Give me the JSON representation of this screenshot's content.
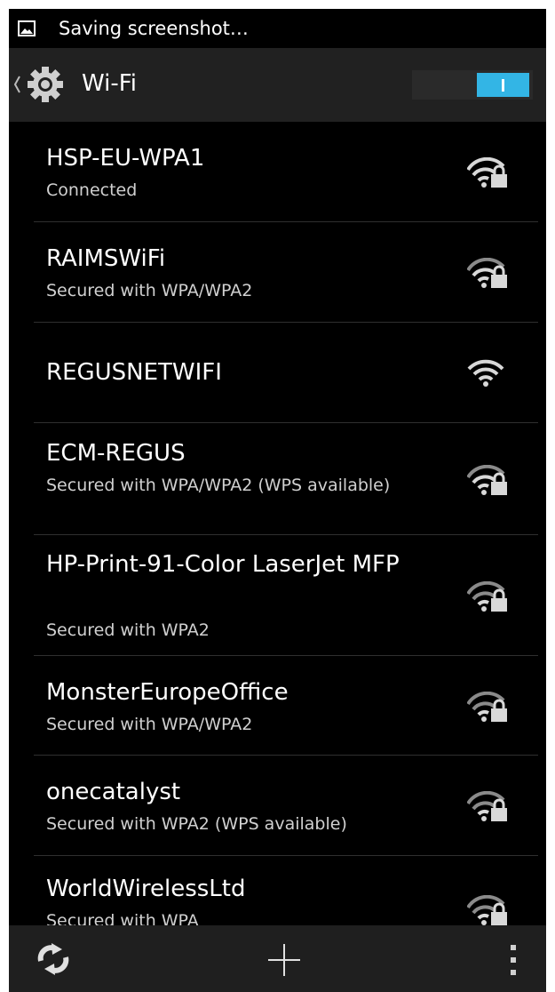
{
  "status_bar": {
    "icon": "image-icon",
    "notification": "Saving screenshot…"
  },
  "action_bar": {
    "back_icon": "chevron-left-icon",
    "settings_icon": "gear-icon",
    "title": "Wi-Fi",
    "toggle_state": "on",
    "accent_color": "#33b5e5"
  },
  "networks": [
    {
      "ssid": "HSP-EU-WPA1",
      "status": "Connected",
      "icon": "wifi-lock-icon"
    },
    {
      "ssid": "RAIMSWiFi",
      "status": "Secured with WPA/WPA2",
      "icon": "wifi-lock-icon"
    },
    {
      "ssid": "REGUSNETWIFI",
      "status": "",
      "icon": "wifi-icon"
    },
    {
      "ssid": "ECM-REGUS",
      "status": "Secured with WPA/WPA2 (WPS available)",
      "icon": "wifi-lock-icon"
    },
    {
      "ssid": "HP-Print-91-Color LaserJet MFP",
      "status": "Secured with WPA2",
      "icon": "wifi-lock-icon"
    },
    {
      "ssid": "MonsterEuropeOffice",
      "status": "Secured with WPA/WPA2",
      "icon": "wifi-lock-icon"
    },
    {
      "ssid": "onecatalyst",
      "status": "Secured with WPA2 (WPS available)",
      "icon": "wifi-lock-icon"
    },
    {
      "ssid": "WorldWirelessLtd",
      "status": "Secured with WPA",
      "icon": "wifi-lock-icon"
    }
  ],
  "bottom_bar": {
    "scan_icon": "refresh-icon",
    "add_icon": "add-icon",
    "menu_icon": "overflow-menu-icon"
  }
}
